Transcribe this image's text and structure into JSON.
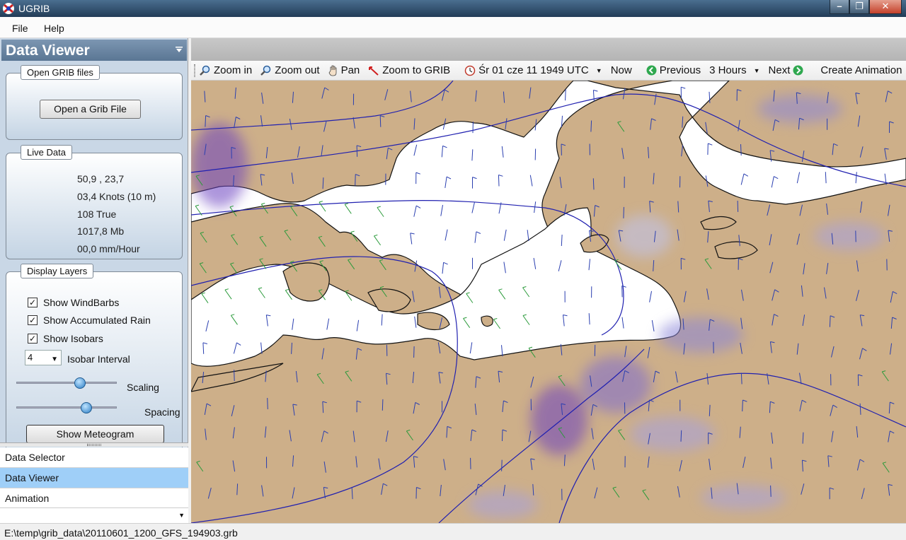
{
  "window": {
    "title": "UGRIB"
  },
  "menu": {
    "items": [
      "File",
      "Help"
    ]
  },
  "panel": {
    "title": "Data Viewer",
    "open_group": {
      "label": "Open GRIB files",
      "button": "Open a Grib File"
    },
    "live_group": {
      "label": "Live Data",
      "position": "50,9 ,  23,7",
      "wind_speed": "03,4 Knots (10 m)",
      "wind_dir": "108 True",
      "pressure": "1017,8 Mb",
      "rain": "00,0 mm/Hour"
    },
    "layers_group": {
      "label": "Display Layers",
      "show_windbarbs": "Show WindBarbs",
      "show_rain": "Show Accumulated Rain",
      "show_isobars": "Show Isobars",
      "isobar_value": "4",
      "isobar_label": "Isobar Interval",
      "scaling_label": "Scaling",
      "scaling_level": 0.65,
      "spacing_label": "Spacing",
      "spacing_level": 0.72,
      "meteogram_button": "Show Meteogram"
    }
  },
  "nav": {
    "items": [
      "Data Selector",
      "Data Viewer",
      "Animation"
    ],
    "selected": "Data Viewer"
  },
  "toolbar": {
    "zoom_in": "Zoom in",
    "zoom_out": "Zoom out",
    "pan": "Pan",
    "zoom_grib": "Zoom to GRIB",
    "time": "Śr 01 cze 11 1949 UTC",
    "now": "Now",
    "previous": "Previous",
    "step": "3 Hours",
    "next": "Next",
    "create_animation": "Create Animation"
  },
  "status": {
    "path": "E:\\temp\\grib_data\\20110601_1200_GFS_194903.grb"
  },
  "colors": {
    "land": "#cdaf89",
    "sea": "#ffffff",
    "isobar": "#2020b0",
    "rain": "#7b5fc0",
    "barb_blue": "#2a3fb0",
    "barb_green": "#2a9a3a",
    "selected_nav": "#9fcff8"
  },
  "icons": [
    "zoom-in-icon",
    "zoom-out-icon",
    "pan-hand-icon",
    "zoom-grib-icon",
    "clock-icon",
    "previous-arrow-icon",
    "next-arrow-icon"
  ]
}
